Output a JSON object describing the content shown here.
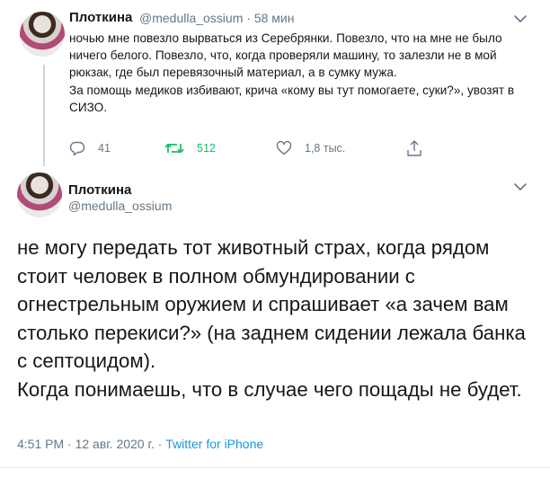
{
  "tweet1": {
    "author_name": "Плоткина",
    "handle": "@medulla_ossium",
    "separator": "·",
    "time_ago": "58 мин",
    "text_para1": "ночью мне повезло вырваться из Серебрянки. Повезло, что на мне не было ничего белого. Повезло, что, когда проверяли машину, то залезли не в мой рюкзак, где был перевязочный материал, а в сумку мужа.",
    "text_para2": "За помощь медиков избивают, крича «кому вы тут помогаете, суки?», увозят в СИЗО.",
    "replies": "41",
    "retweets": "512",
    "likes": "1,8 тыс."
  },
  "tweet2": {
    "author_name": "Плоткина",
    "handle": "@medulla_ossium",
    "text_para1": "не могу передать тот животный страх, когда рядом стоит человек в полном обмундировании с огнестрельным оружием и спрашивает «а зачем вам столько перекиси?» (на заднем сидении лежала банка с септоцидом).",
    "text_para2": "Когда понимаешь, что в случае чего пощады не будет.",
    "timestamp": "4:51 PM · 12 авг. 2020 г. · ",
    "source": "Twitter for iPhone"
  },
  "icons": {
    "reply": "comment-bubble-icon",
    "retweet": "retweet-arrows-icon",
    "like": "heart-icon",
    "share": "share-upload-icon",
    "menu": "chevron-down-icon"
  },
  "colors": {
    "text": "#14171a",
    "secondary": "#657786",
    "retweet_active": "#17bf63",
    "link": "#1b95e0"
  }
}
